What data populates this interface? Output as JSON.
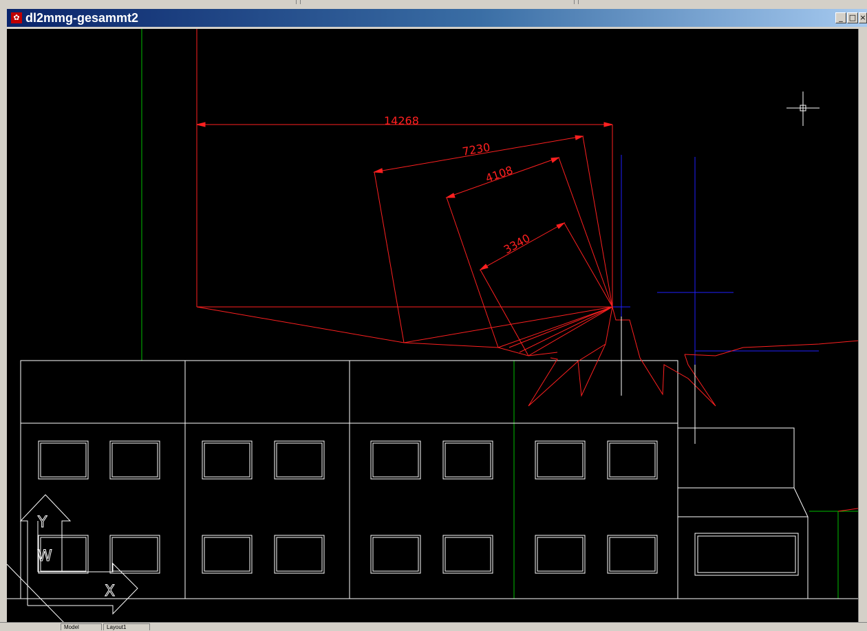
{
  "window": {
    "title": "dl2mmg-gesammt2",
    "app_icon": "autocad-app-icon",
    "buttons": [
      {
        "name": "minimize-button",
        "glyph": "_"
      },
      {
        "name": "maximize-button",
        "glyph": "□"
      },
      {
        "name": "close-button",
        "glyph": "×"
      }
    ]
  },
  "drawing": {
    "background": "#000000",
    "dimensions": [
      {
        "name": "dimension-14268",
        "value": "14268"
      },
      {
        "name": "dimension-7230",
        "value": "7230"
      },
      {
        "name": "dimension-4108",
        "value": "4108"
      },
      {
        "name": "dimension-3340",
        "value": "3340"
      }
    ],
    "ucs_icon": {
      "y_label": "Y",
      "w_label": "W",
      "x_label": "X"
    },
    "colors": {
      "dimension": "#ff2020",
      "building": "#ffffff",
      "grid_line": "#00c000",
      "axis_line": "#2020ff"
    }
  },
  "layout_tabs": [
    "Model",
    "Layout1"
  ]
}
